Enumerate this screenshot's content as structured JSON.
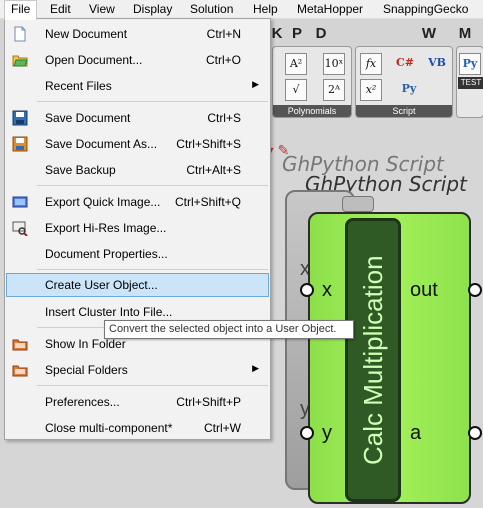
{
  "menubar": {
    "items": [
      {
        "label": "File",
        "active": true
      },
      {
        "label": "Edit"
      },
      {
        "label": "View"
      },
      {
        "label": "Display"
      },
      {
        "label": "Solution"
      },
      {
        "label": "Help"
      },
      {
        "label": "MetaHopper"
      },
      {
        "label": "SnappingGecko"
      }
    ]
  },
  "toolbar": {
    "tab_letters": [
      "K",
      "P",
      "D",
      "W",
      "M"
    ],
    "panels": [
      {
        "label": "Polynomials",
        "tools": [
          "A²",
          "10ˣ",
          "√",
          "2ᴬ"
        ]
      },
      {
        "label": "Script",
        "tools": [
          "fx",
          "x²",
          "C#",
          "VB",
          "Py"
        ]
      }
    ],
    "test_label": "TEST"
  },
  "file_menu": {
    "items": [
      {
        "label": "New Document",
        "shortcut": "Ctrl+N",
        "icon": "new-document-icon"
      },
      {
        "label": "Open Document...",
        "shortcut": "Ctrl+O",
        "icon": "open-folder-icon"
      },
      {
        "label": "Recent Files",
        "submenu": true
      },
      {
        "label": "Save Document",
        "shortcut": "Ctrl+S",
        "icon": "save-disk-blue-icon"
      },
      {
        "label": "Save Document As...",
        "shortcut": "Ctrl+Shift+S",
        "icon": "save-disk-orange-icon"
      },
      {
        "label": "Save Backup",
        "shortcut": "Ctrl+Alt+S"
      },
      {
        "label": "Export Quick Image...",
        "shortcut": "Ctrl+Shift+Q",
        "icon": "export-image-icon"
      },
      {
        "label": "Export Hi-Res Image...",
        "icon": "export-hires-icon"
      },
      {
        "label": "Document Properties..."
      },
      {
        "label": "Create User Object...",
        "highlighted": true
      },
      {
        "label": "Insert Cluster Into File..."
      },
      {
        "label": "Show In Folder",
        "icon": "folder-icon"
      },
      {
        "label": "Special Folders",
        "submenu": true,
        "icon": "folder-icon"
      },
      {
        "label": "Preferences...",
        "shortcut": "Ctrl+Shift+P"
      },
      {
        "label": "Close multi-component*",
        "shortcut": "Ctrl+W"
      }
    ]
  },
  "tooltip": {
    "text": "Convert the selected object into a User Object."
  },
  "canvas": {
    "title_back": "GhPython Script",
    "title_front": "GhPython Script",
    "component_name": "Calc Multiplication",
    "input_x": "x",
    "input_y": "y",
    "output_out": "out",
    "output_a": "a",
    "ghost_x": "x",
    "ghost_y": "y"
  },
  "colors": {
    "menu_highlight": "#cce4f7",
    "component_green": "#a3f05a",
    "component_dark": "#2f5a26"
  }
}
